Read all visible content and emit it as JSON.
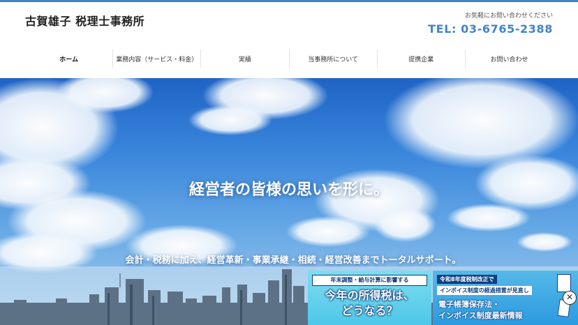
{
  "header": {
    "site_title": "古賀雄子 税理士事務所",
    "contact_note": "お気軽にお問い合わせください",
    "tel": "TEL: 03-6765-2388"
  },
  "nav": {
    "items": [
      {
        "label": "ホーム",
        "active": true
      },
      {
        "label": "業務内容（サービス・料金）"
      },
      {
        "label": "実績"
      },
      {
        "label": "当事務所について"
      },
      {
        "label": "提携企業"
      },
      {
        "label": "お問い合わせ"
      }
    ]
  },
  "hero": {
    "headline": "経営者の皆様の思いを形に。",
    "subline": "会計・税務に加え、経営革新・事業承継・相続・経営改善までトータルサポート。"
  },
  "banners": {
    "b1_top": "年末調整・給与計算に影響する",
    "b1_main1": "今年の所得税は、",
    "b1_main2": "どうなる？",
    "b2_line1": "令和8年度税制改正で",
    "b2_line2": "インボイス制度の経過措置が見直し",
    "b2_line3a": "電子帳簿保存法・",
    "b2_line3b": "インボイス制度最新情報"
  },
  "close_icon": "close-icon"
}
